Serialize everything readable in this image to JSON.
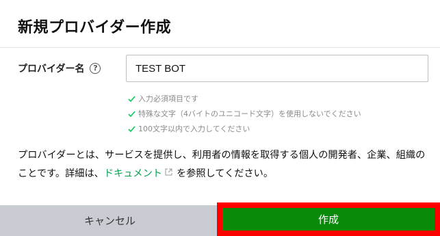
{
  "dialog": {
    "title": "新規プロバイダー作成",
    "field": {
      "label": "プロバイダー名",
      "help_icon": "question-circle-icon",
      "value": "TEST BOT"
    },
    "rules": [
      "入力必須項目です",
      "特殊な文字（4バイトのユニコード文字）を使用しないでください",
      "100文字以内で入力してください"
    ],
    "description": {
      "before_link": "プロバイダーとは、サービスを提供し、利用者の情報を取得する個人の開発者、企業、組織のことです。詳細は、",
      "link_text": "ドキュメント",
      "after_link": "を参照してください。"
    },
    "footer": {
      "cancel_label": "キャンセル",
      "create_label": "作成"
    }
  },
  "colors": {
    "primary_green": "#0a8a0a",
    "link_green": "#06a050",
    "check_green": "#06c755",
    "highlight_red": "#ff0000",
    "cancel_gray": "#c9cdd3"
  }
}
